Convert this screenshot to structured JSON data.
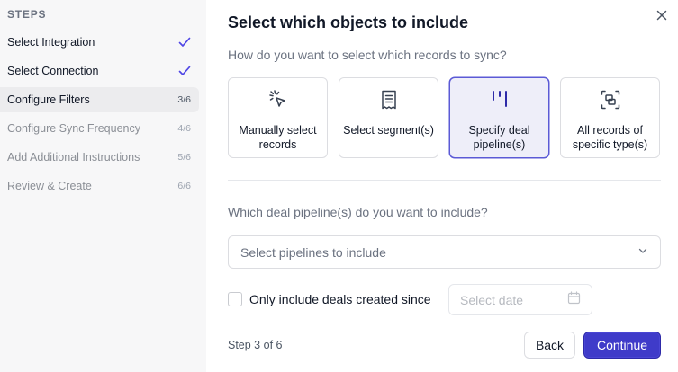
{
  "sidebar": {
    "title": "STEPS",
    "steps": [
      {
        "label": "Select Integration",
        "status": "done",
        "count": ""
      },
      {
        "label": "Select Connection",
        "status": "done",
        "count": ""
      },
      {
        "label": "Configure Filters",
        "status": "active",
        "count": "3/6"
      },
      {
        "label": "Configure Sync Frequency",
        "status": "todo",
        "count": "4/6"
      },
      {
        "label": "Add Additional Instructions",
        "status": "todo",
        "count": "5/6"
      },
      {
        "label": "Review & Create",
        "status": "todo",
        "count": "6/6"
      }
    ],
    "check_icon": "check-icon",
    "check_color": "#4f46e5"
  },
  "main": {
    "title": "Select which objects to include",
    "close_icon": "close-icon",
    "question1": "How do you want to select which records to sync?",
    "options": [
      {
        "label": "Manually select records",
        "icon": "cursor-click-icon",
        "selected": false
      },
      {
        "label": "Select segment(s)",
        "icon": "receipt-icon",
        "selected": false
      },
      {
        "label": "Specify deal pipeline(s)",
        "icon": "pipeline-icon",
        "selected": true
      },
      {
        "label": "All records of specific type(s)",
        "icon": "objects-icon",
        "selected": false
      }
    ],
    "question2": "Which deal pipeline(s) do you want to include?",
    "pipelines_select": {
      "placeholder": "Select pipelines to include",
      "icon": "chevron-down-icon"
    },
    "created_since": {
      "label": "Only include deals created since",
      "checked": false
    },
    "date_input": {
      "placeholder": "Select date",
      "icon": "calendar-icon"
    },
    "footer": {
      "step_text": "Step 3 of 6",
      "back_label": "Back",
      "continue_label": "Continue"
    },
    "accent_color": "#3f3bc9"
  }
}
